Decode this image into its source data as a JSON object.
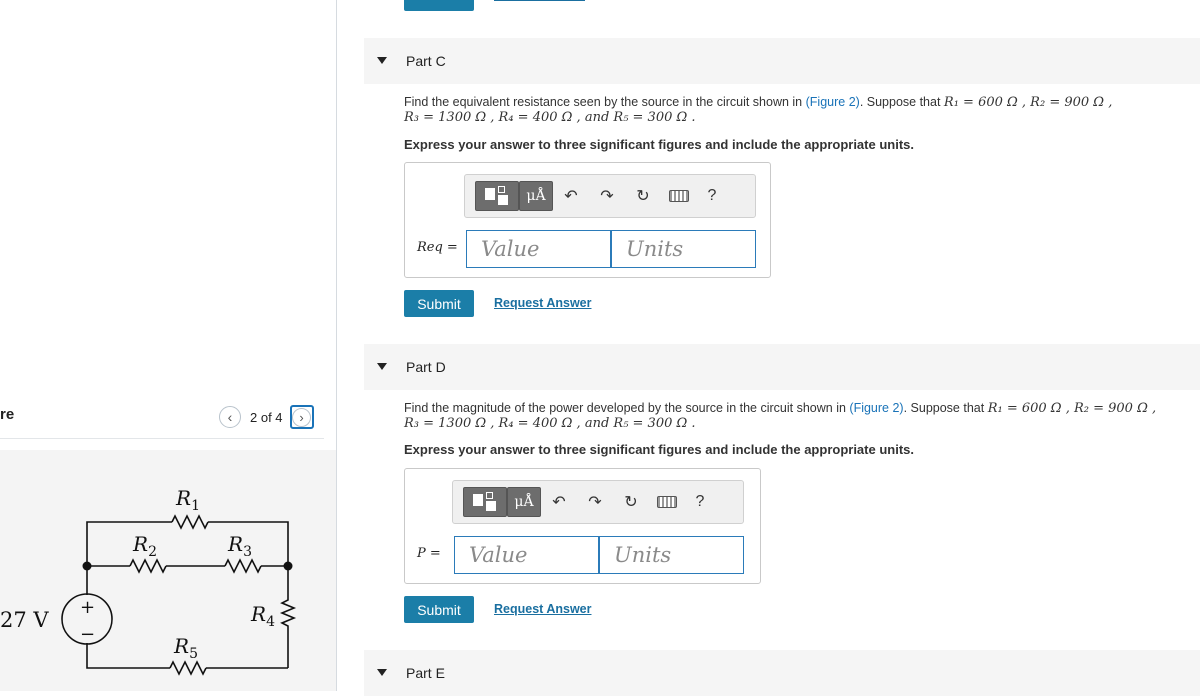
{
  "left_panel": {
    "title_fragment": "re",
    "pager": {
      "text": "2 of 4",
      "prev_glyph": "‹",
      "next_glyph": "›"
    },
    "figure": {
      "voltage_label": "27 V",
      "plus": "+",
      "minus": "−",
      "resistor_labels": {
        "r1": {
          "base": "R",
          "sub": "1"
        },
        "r2": {
          "base": "R",
          "sub": "2"
        },
        "r3": {
          "base": "R",
          "sub": "3"
        },
        "r4": {
          "base": "R",
          "sub": "4"
        },
        "r5": {
          "base": "R",
          "sub": "5"
        }
      }
    }
  },
  "parts": [
    {
      "title": "Part C",
      "question": {
        "pre": "Find the equivalent resistance seen by the source in the circuit shown in ",
        "link": "(Figure 2)",
        "post": ". Suppose that ",
        "values_line1": "R₁ = 600  Ω , R₂ = 900  Ω ,",
        "values_line2": "R₃ = 1300  Ω , R₄ = 400  Ω , and R₅ = 300  Ω ."
      },
      "instruction": "Express your answer to three significant figures and include the appropriate units.",
      "variable": "Req =",
      "value_placeholder": "Value",
      "units_placeholder": "Units",
      "submit_label": "Submit",
      "request_label": "Request Answer"
    },
    {
      "title": "Part D",
      "question": {
        "pre": "Find the magnitude of the power developed by the source in the circuit shown in ",
        "link": "(Figure 2)",
        "post": ". Suppose that ",
        "values_line1": "R₁ = 600  Ω , R₂ = 900  Ω ,",
        "values_line2": "R₃ = 1300  Ω , R₄ = 400  Ω , and R₅ = 300  Ω ."
      },
      "instruction": "Express your answer to three significant figures and include the appropriate units.",
      "variable": "P =",
      "value_placeholder": "Value",
      "units_placeholder": "Units",
      "submit_label": "Submit",
      "request_label": "Request Answer"
    },
    {
      "title": "Part E"
    }
  ],
  "toolbar": {
    "mu_label": "μÅ",
    "undo": "↶",
    "redo": "↷",
    "reset": "↻",
    "help": "?"
  }
}
